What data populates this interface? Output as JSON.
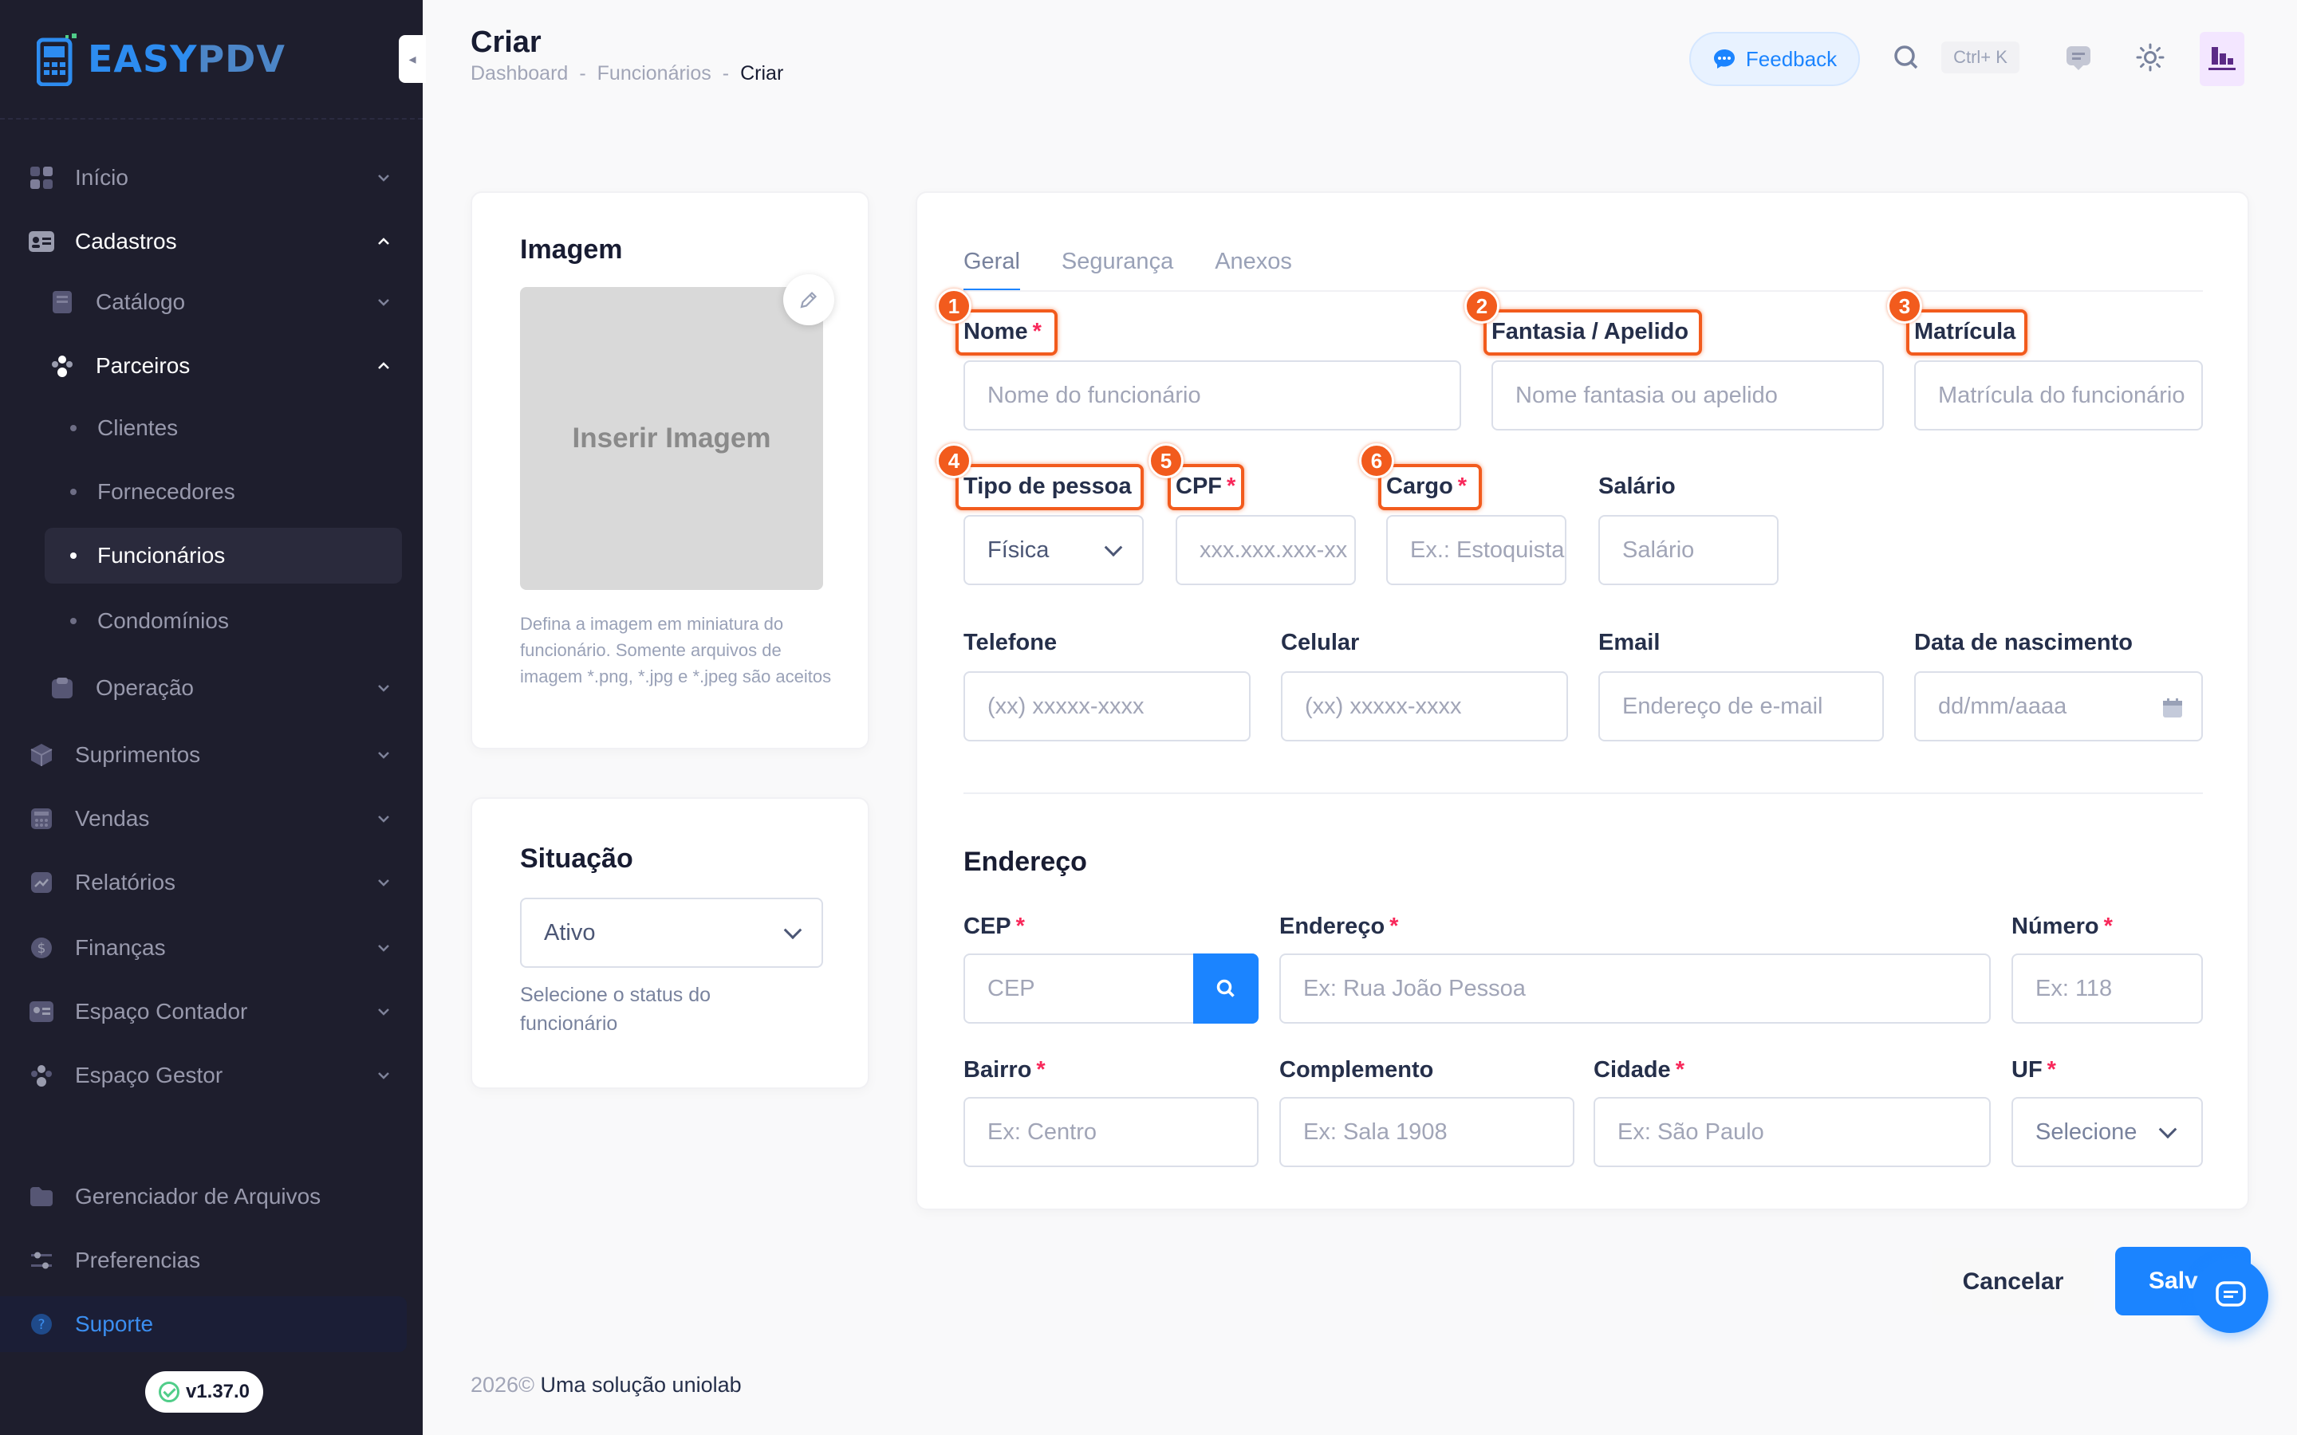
{
  "app": {
    "logo_main": "EASY",
    "logo_accent": "PDV",
    "version": "v1.37.0"
  },
  "sidebar": {
    "items": [
      {
        "label": "Início",
        "icon": "grid-icon"
      },
      {
        "label": "Cadastros",
        "icon": "address-card-icon"
      },
      {
        "label": "Catálogo",
        "icon": "book-icon"
      },
      {
        "label": "Parceiros",
        "icon": "people-icon"
      },
      {
        "label": "Clientes"
      },
      {
        "label": "Fornecedores"
      },
      {
        "label": "Funcionários"
      },
      {
        "label": "Condomínios"
      },
      {
        "label": "Operação",
        "icon": "briefcase-icon"
      },
      {
        "label": "Suprimentos",
        "icon": "cube-icon"
      },
      {
        "label": "Vendas",
        "icon": "calculator-icon"
      },
      {
        "label": "Relatórios",
        "icon": "chart-icon"
      },
      {
        "label": "Finanças",
        "icon": "dollar-icon"
      },
      {
        "label": "Espaço Contador",
        "icon": "id-card-icon"
      },
      {
        "label": "Espaço Gestor",
        "icon": "manager-icon"
      },
      {
        "label": "Gerenciador de Arquivos",
        "icon": "folder-icon"
      },
      {
        "label": "Preferencias",
        "icon": "sliders-icon"
      },
      {
        "label": "Suporte",
        "icon": "question-icon"
      }
    ]
  },
  "header": {
    "title": "Criar",
    "breadcrumb": [
      "Dashboard",
      "-",
      "Funcionários",
      "-",
      "Criar"
    ],
    "feedback_label": "Feedback",
    "shortcut": "Ctrl+ K"
  },
  "image_card": {
    "title": "Imagem",
    "placeholder": "Inserir Imagem",
    "help": "Defina a imagem em miniatura do funcionário. Somente arquivos de imagem *.png, *.jpg e *.jpeg são aceitos"
  },
  "status_card": {
    "title": "Situação",
    "value": "Ativo",
    "help": "Selecione o status do funcionário"
  },
  "tabs": [
    "Geral",
    "Segurança",
    "Anexos"
  ],
  "form": {
    "nome": {
      "label": "Nome",
      "placeholder": "Nome do funcionário",
      "required": "*"
    },
    "fantasia": {
      "label": "Fantasia / Apelido",
      "placeholder": "Nome fantasia ou apelido"
    },
    "matricula": {
      "label": "Matrícula",
      "placeholder": "Matrícula do funcionário"
    },
    "tipo": {
      "label": "Tipo de pessoa",
      "value": "Física"
    },
    "cpf": {
      "label": "CPF",
      "placeholder": "xxx.xxx.xxx-xx",
      "required": "*"
    },
    "cargo": {
      "label": "Cargo",
      "placeholder": "Ex.: Estoquista",
      "required": "*"
    },
    "salario": {
      "label": "Salário",
      "placeholder": "Salário"
    },
    "telefone": {
      "label": "Telefone",
      "placeholder": "(xx) xxxxx-xxxx"
    },
    "celular": {
      "label": "Celular",
      "placeholder": "(xx) xxxxx-xxxx"
    },
    "email": {
      "label": "Email",
      "placeholder": "Endereço de e-mail"
    },
    "nascimento": {
      "label": "Data de nascimento",
      "placeholder": "dd/mm/aaaa"
    }
  },
  "address": {
    "title": "Endereço",
    "cep": {
      "label": "CEP",
      "placeholder": "CEP",
      "required": "*"
    },
    "endereco": {
      "label": "Endereço",
      "placeholder": "Ex: Rua João Pessoa",
      "required": "*"
    },
    "numero": {
      "label": "Número",
      "placeholder": "Ex: 118",
      "required": "*"
    },
    "bairro": {
      "label": "Bairro",
      "placeholder": "Ex: Centro",
      "required": "*"
    },
    "complemento": {
      "label": "Complemento",
      "placeholder": "Ex: Sala 1908"
    },
    "cidade": {
      "label": "Cidade",
      "placeholder": "Ex: São Paulo",
      "required": "*"
    },
    "uf": {
      "label": "UF",
      "value": "Selecione",
      "required": "*"
    }
  },
  "annotations": [
    "1",
    "2",
    "3",
    "4",
    "5",
    "6"
  ],
  "actions": {
    "cancel": "Cancelar",
    "save": "Salvar"
  },
  "footer": {
    "year": "2026©",
    "brand": "Uma solução uniolab"
  },
  "colors": {
    "accent": "#1b84ff",
    "annotation": "#f25b1d",
    "sidebar_bg": "#1e1e2d",
    "required": "#f8285a"
  }
}
